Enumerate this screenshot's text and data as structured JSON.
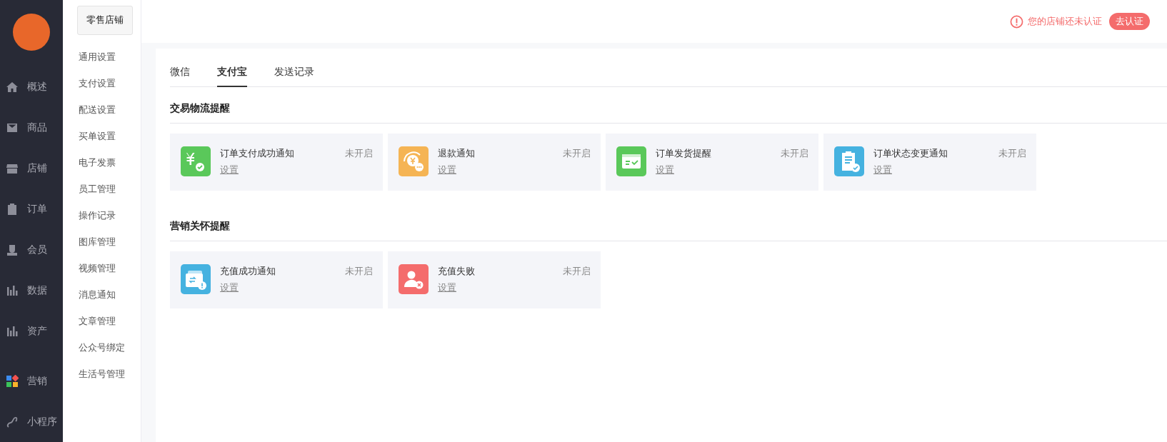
{
  "sidebar": {
    "items": [
      {
        "label": "概述",
        "selected": false
      },
      {
        "label": "商品",
        "selected": false
      },
      {
        "label": "店铺",
        "selected": false
      },
      {
        "label": "订单",
        "selected": false
      },
      {
        "label": "会员",
        "selected": false
      },
      {
        "label": "数据",
        "selected": false
      },
      {
        "label": "资产",
        "selected": false
      }
    ],
    "bottom_items": [
      {
        "label": "营销"
      },
      {
        "label": "小程序"
      }
    ]
  },
  "submenu": {
    "title": "零售店铺",
    "items": [
      {
        "label": "通用设置"
      },
      {
        "label": "支付设置"
      },
      {
        "label": "配送设置"
      },
      {
        "label": "买单设置"
      },
      {
        "label": "电子发票"
      },
      {
        "label": "员工管理"
      },
      {
        "label": "操作记录"
      },
      {
        "label": "图库管理"
      },
      {
        "label": "视频管理"
      },
      {
        "label": "消息通知"
      },
      {
        "label": "文章管理"
      },
      {
        "label": "公众号绑定"
      },
      {
        "label": "生活号管理"
      }
    ]
  },
  "header": {
    "warning": "您的店铺还未认证",
    "action": "去认证"
  },
  "tabs": [
    {
      "label": "微信",
      "selected": false
    },
    {
      "label": "支付宝",
      "selected": true
    },
    {
      "label": "发送记录",
      "selected": false
    }
  ],
  "sections": [
    {
      "title": "交易物流提醒",
      "cards": [
        {
          "title": "订单支付成功通知",
          "status": "未开启",
          "link": "设置",
          "color": "#5ac85a"
        },
        {
          "title": "退款通知",
          "status": "未开启",
          "link": "设置",
          "color": "#f5b454"
        },
        {
          "title": "订单发货提醒",
          "status": "未开启",
          "link": "设置",
          "color": "#5ac85a"
        },
        {
          "title": "订单状态变更通知",
          "status": "未开启",
          "link": "设置",
          "color": "#45b2e0"
        }
      ]
    },
    {
      "title": "营销关怀提醒",
      "cards": [
        {
          "title": "充值成功通知",
          "status": "未开启",
          "link": "设置",
          "color": "#45b2e0"
        },
        {
          "title": "充值失败",
          "status": "未开启",
          "link": "设置",
          "color": "#f46c6c"
        }
      ]
    }
  ]
}
